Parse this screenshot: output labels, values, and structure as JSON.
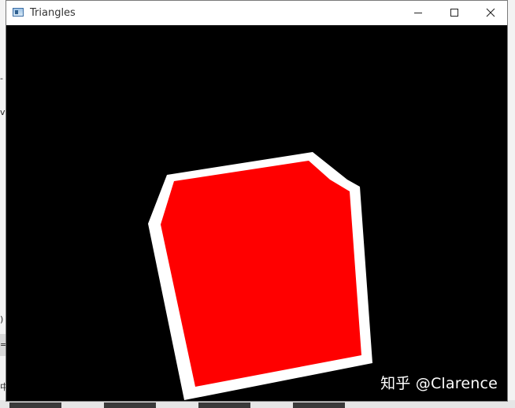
{
  "window": {
    "title": "Triangles",
    "controls": {
      "minimize": "minimize-icon",
      "maximize": "maximize-icon",
      "close": "close-icon"
    }
  },
  "scene": {
    "background_color": "#000000",
    "outer_shape_color": "#ffffff",
    "inner_shape_color": "#ff0000"
  },
  "watermark": {
    "text": "知乎 @Clarence"
  },
  "background_fragments": {
    "line1": "-",
    "line2": "ve",
    "line3": ")",
    "line4": "= (",
    "line5": "中"
  }
}
